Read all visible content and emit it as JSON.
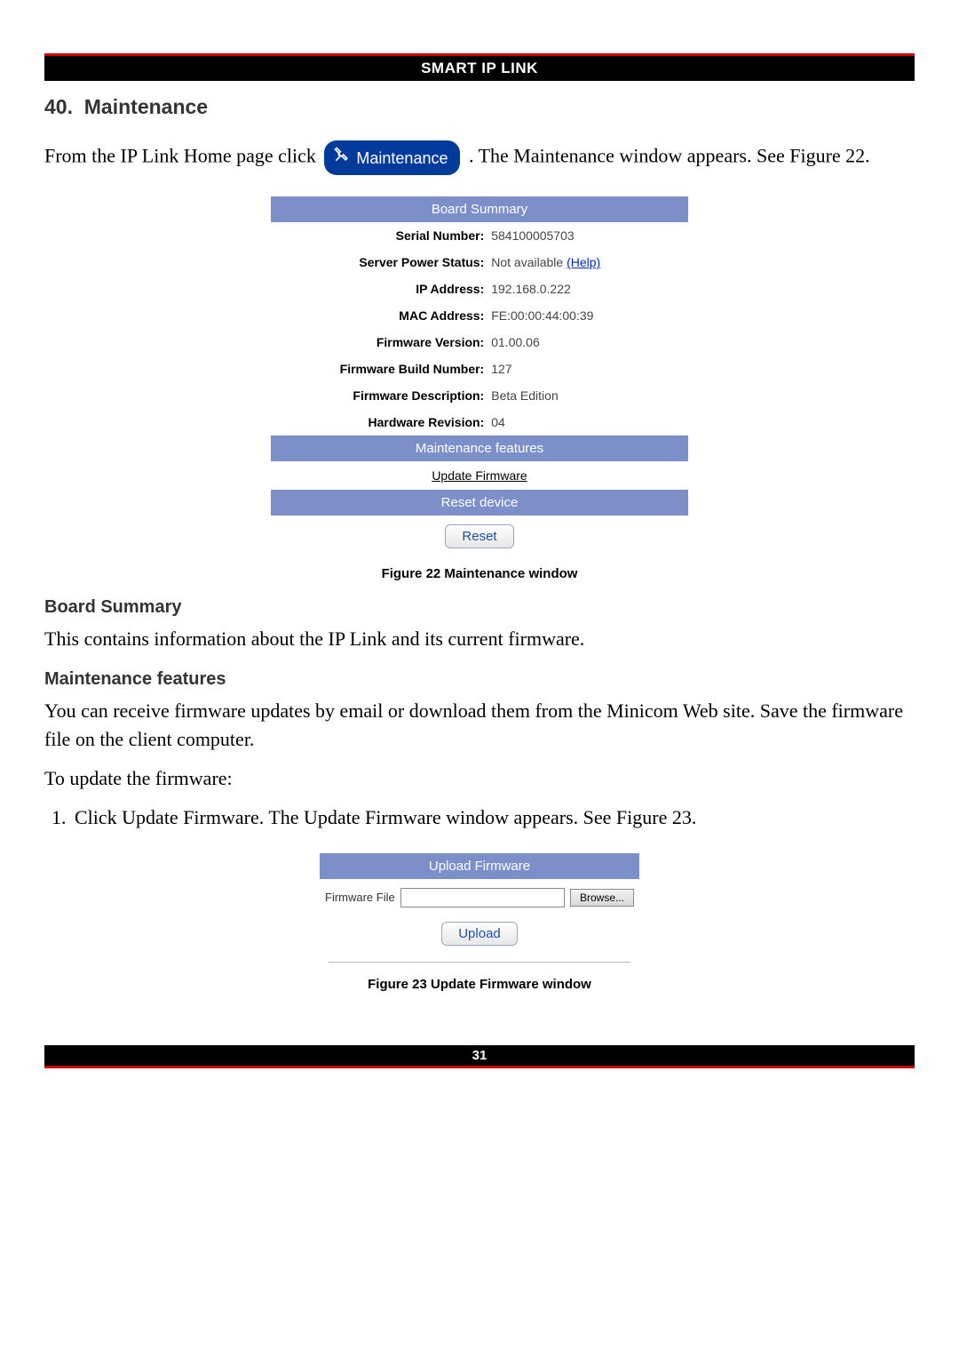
{
  "header": {
    "title": "SMART IP LINK"
  },
  "section": {
    "number": "40.",
    "title": "Maintenance",
    "intro_before": "From the IP Link Home page click ",
    "maint_button_label": "Maintenance",
    "intro_after": ". The Maintenance window appears. See Figure 22."
  },
  "board_summary": {
    "header": "Board Summary",
    "rows": [
      {
        "label": "Serial Number:",
        "value": "584100005703"
      },
      {
        "label": "Server Power Status:",
        "value": "Not available",
        "help": "(Help)"
      },
      {
        "label": "IP Address:",
        "value": "192.168.0.222"
      },
      {
        "label": "MAC Address:",
        "value": "FE:00:00:44:00:39"
      },
      {
        "label": "Firmware Version:",
        "value": "01.00.06"
      },
      {
        "label": "Firmware Build Number:",
        "value": "127"
      },
      {
        "label": "Firmware Description:",
        "value": "Beta Edition"
      },
      {
        "label": "Hardware Revision:",
        "value": "04"
      }
    ]
  },
  "maintenance_features": {
    "header": "Maintenance features",
    "update_link": "Update Firmware"
  },
  "reset_device": {
    "header": "Reset device",
    "button": "Reset"
  },
  "figure22_caption": "Figure 22 Maintenance window",
  "body": {
    "board_summary_heading": "Board Summary",
    "board_summary_text": "This contains information about the IP Link and its current firmware.",
    "maint_features_heading": "Maintenance features",
    "maint_features_text": "You can receive firmware updates by email or download them from the Minicom Web site. Save the firmware file on the client computer.",
    "to_update": "To update the firmware:",
    "step1": "Click Update Firmware. The Update Firmware window appears. See Figure 23."
  },
  "upload_firmware": {
    "header": "Upload Firmware",
    "file_label": "Firmware File",
    "browse": "Browse...",
    "upload": "Upload"
  },
  "figure23_caption": "Figure 23 Update Firmware window",
  "footer": {
    "page": "31"
  }
}
